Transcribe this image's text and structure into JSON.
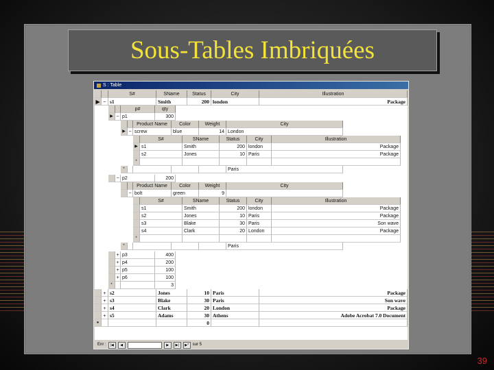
{
  "slide": {
    "title": "Sous-Tables Imbriquées",
    "page_number": "39"
  },
  "window": {
    "title": "S : Table",
    "record_label": "Enr :",
    "record_of": "sur 5"
  },
  "outer_headers": [
    "S#",
    "SName",
    "Status",
    "City",
    "Illustration"
  ],
  "outer_first": {
    "sid": "s1",
    "sname": "Smith",
    "status": "200",
    "city": "london",
    "illustration": "Package"
  },
  "p_headers": [
    "p#",
    "qty"
  ],
  "p1": {
    "pid": "p1",
    "qty": "300"
  },
  "prod_headers": [
    "Product Name",
    "Color",
    "Weight",
    "City"
  ],
  "prod1": {
    "name": "screw",
    "color": "blue",
    "weight": "14",
    "city": "London"
  },
  "inner_headers": [
    "S#",
    "SName",
    "Status",
    "City",
    "Illustration"
  ],
  "inner1": [
    {
      "sid": "s1",
      "sname": "Smith",
      "status": "200",
      "city": "london",
      "illustration": "Package"
    },
    {
      "sid": "s2",
      "sname": "Jones",
      "status": "10",
      "city": "Paris",
      "illustration": "Package"
    }
  ],
  "prod1_new_city": "Paris",
  "p2": {
    "pid": "p2",
    "qty": "200"
  },
  "prod2": {
    "name": "bolt",
    "color": "green",
    "weight": "9",
    "city": ""
  },
  "inner2": [
    {
      "sid": "s1",
      "sname": "Smith",
      "status": "200",
      "city": "london",
      "illustration": "Package"
    },
    {
      "sid": "s2",
      "sname": "Jones",
      "status": "10",
      "city": "Paris",
      "illustration": "Package"
    },
    {
      "sid": "s3",
      "sname": "Blake",
      "status": "30",
      "city": "Paris",
      "illustration": "Son wave"
    },
    {
      "sid": "s4",
      "sname": "Clark",
      "status": "20",
      "city": "London",
      "illustration": "Package"
    }
  ],
  "prod2_new_city": "Paris",
  "p_rest": [
    {
      "pid": "p3",
      "qty": "400"
    },
    {
      "pid": "p4",
      "qty": "200"
    },
    {
      "pid": "p5",
      "qty": "100"
    },
    {
      "pid": "p6",
      "qty": "100"
    }
  ],
  "p_new_qty": "3",
  "outer_rest": [
    {
      "sid": "s2",
      "sname": "Jones",
      "status": "10",
      "city": "Paris",
      "illustration": "Package"
    },
    {
      "sid": "s3",
      "sname": "Blake",
      "status": "30",
      "city": "Paris",
      "illustration": "Son wave"
    },
    {
      "sid": "s4",
      "sname": "Clark",
      "status": "20",
      "city": "London",
      "illustration": "Package"
    },
    {
      "sid": "s5",
      "sname": "Adams",
      "status": "30",
      "city": "Athens",
      "illustration": "Adobe Acrobat 7.0 Document"
    }
  ],
  "outer_new_status": "0",
  "colors": {
    "title": "#f2e23a",
    "page_number": "#cc2a2a",
    "titlebar": "#0a246a"
  }
}
